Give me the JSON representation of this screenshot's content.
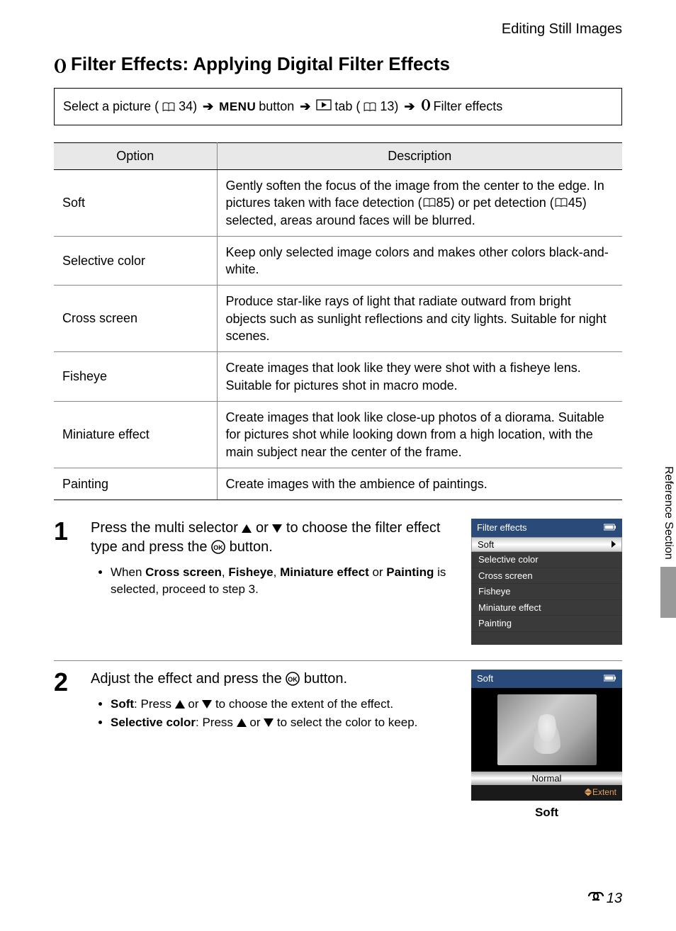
{
  "header": {
    "section": "Editing Still Images"
  },
  "title": "Filter Effects: Applying Digital Filter Effects",
  "nav": {
    "p1": "Select a picture (",
    "ref1": "34)",
    "menu": "MENU",
    "p2": " button ",
    "p3": " tab (",
    "ref2": "13) ",
    "p4": " Filter effects"
  },
  "table": {
    "h1": "Option",
    "h2": "Description",
    "rows": [
      {
        "opt": "Soft",
        "desc_a": "Gently soften the focus of the image from the center to the edge. In pictures taken with face detection (",
        "ref_a": "85) or pet detection (",
        "ref_b": "45) selected, areas around faces will be blurred."
      },
      {
        "opt": "Selective color",
        "desc": "Keep only selected image colors and makes other colors black-and-white."
      },
      {
        "opt": "Cross screen",
        "desc": "Produce star-like rays of light that radiate outward from bright objects such as sunlight reflections and city lights. Suitable for night scenes."
      },
      {
        "opt": "Fisheye",
        "desc": "Create images that look like they were shot with a fisheye lens. Suitable for pictures shot in macro mode."
      },
      {
        "opt": "Miniature effect",
        "desc": "Create images that look like close-up photos of a diorama. Suitable for pictures shot while looking down from a high location, with the main subject near the center of the frame."
      },
      {
        "opt": "Painting",
        "desc": "Create images with the ambience of paintings."
      }
    ]
  },
  "steps": {
    "s1": {
      "num": "1",
      "line_a": "Press the multi selector ",
      "line_b": " or ",
      "line_c": " to choose the filter effect type and press the ",
      "line_d": " button.",
      "bullet_a": "When ",
      "bullet_b1": "Cross screen",
      "bullet_b2": ", ",
      "bullet_b3": "Fisheye",
      "bullet_b4": ", ",
      "bullet_b5": "Miniature effect",
      "bullet_b6": " or ",
      "bullet_b7": "Painting",
      "bullet_b8": " is selected, proceed to step 3."
    },
    "s2": {
      "num": "2",
      "line_a": "Adjust the effect and press the ",
      "line_b": " button.",
      "b1a": "Soft",
      "b1b": ": Press ",
      "b1c": " or ",
      "b1d": " to choose the extent of the effect.",
      "b2a": "Selective color",
      "b2b": ": Press ",
      "b2c": " or ",
      "b2d": " to select the color to keep."
    }
  },
  "screen1": {
    "title": "Filter effects",
    "items": [
      "Soft",
      "Selective color",
      "Cross screen",
      "Fisheye",
      "Miniature effect",
      "Painting"
    ]
  },
  "screen2": {
    "title": "Soft",
    "slider": "Normal",
    "extent": "Extent",
    "caption": "Soft"
  },
  "sidetab": "Reference Section",
  "pagenum": "13"
}
